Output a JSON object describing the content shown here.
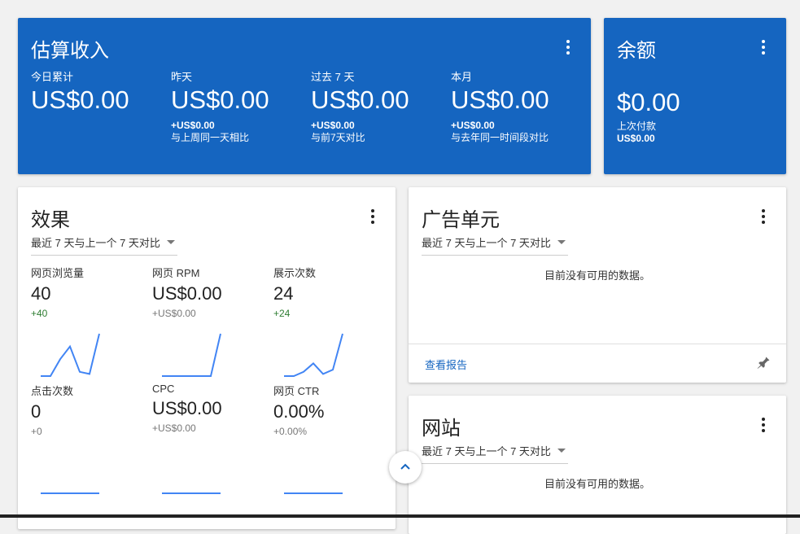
{
  "estimated": {
    "title": "估算收入",
    "columns": [
      {
        "label": "今日累计",
        "value": "US$0.00",
        "delta": "",
        "compare": ""
      },
      {
        "label": "昨天",
        "value": "US$0.00",
        "delta": "+US$0.00",
        "compare": "与上周同一天相比"
      },
      {
        "label": "过去 7 天",
        "value": "US$0.00",
        "delta": "+US$0.00",
        "compare": "与前7天对比"
      },
      {
        "label": "本月",
        "value": "US$0.00",
        "delta": "+US$0.00",
        "compare": "与去年同一时间段对比"
      }
    ]
  },
  "balance": {
    "title": "余额",
    "value": "$0.00",
    "last_payment_label": "上次付款",
    "last_payment_value": "US$0.00"
  },
  "performance": {
    "title": "效果",
    "period": "最近 7 天与上一个 7 天对比",
    "metrics": [
      {
        "label": "网页浏览量",
        "value": "40",
        "delta": "+40",
        "spark": [
          0,
          0,
          0.4,
          0.7,
          0.1,
          0.05,
          1
        ]
      },
      {
        "label": "网页 RPM",
        "value": "US$0.00",
        "delta": "+US$0.00",
        "spark": [
          0,
          0,
          0,
          0,
          0,
          0,
          1
        ]
      },
      {
        "label": "展示次数",
        "value": "24",
        "delta": "+24",
        "spark": [
          0,
          0,
          0.1,
          0.3,
          0.05,
          0.15,
          1
        ]
      },
      {
        "label": "点击次数",
        "value": "0",
        "delta": "+0",
        "spark": [
          0,
          0,
          0,
          0,
          0,
          0,
          0
        ]
      },
      {
        "label": "CPC",
        "value": "US$0.00",
        "delta": "+US$0.00",
        "spark": [
          0,
          0,
          0,
          0,
          0,
          0,
          0
        ]
      },
      {
        "label": "网页 CTR",
        "value": "0.00%",
        "delta": "+0.00%",
        "spark": [
          0,
          0,
          0,
          0,
          0,
          0,
          0
        ]
      }
    ]
  },
  "ad_units": {
    "title": "广告单元",
    "period": "最近 7 天与上一个 7 天对比",
    "empty": "目前没有可用的数据。",
    "report_link": "查看报告"
  },
  "sites": {
    "title": "网站",
    "period": "最近 7 天与上一个 7 天对比",
    "empty": "目前没有可用的数据。"
  },
  "colors": {
    "accent": "#1565c0",
    "positive": "#2e7d32",
    "spark": "#4285f4"
  },
  "icons": [
    "more-vert-icon",
    "pin-icon",
    "chevron-up-icon",
    "dropdown-caret-icon"
  ]
}
